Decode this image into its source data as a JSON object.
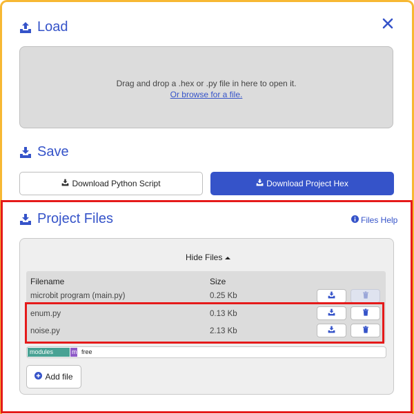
{
  "load": {
    "title": "Load",
    "drop_text": "Drag and drop a .hex or .py file in here to open it.",
    "browse_link": "Or browse for a file."
  },
  "save": {
    "title": "Save",
    "download_python_label": "Download Python Script",
    "download_hex_label": "Download Project Hex"
  },
  "project": {
    "title": "Project Files",
    "help_link": "Files Help",
    "hide_files_label": "Hide Files",
    "columns": {
      "filename": "Filename",
      "size": "Size"
    },
    "files": [
      {
        "name": "microbit program (main.py)",
        "size": "0.25 Kb",
        "deletable": false
      },
      {
        "name": "enum.py",
        "size": "0.13 Kb",
        "deletable": true
      },
      {
        "name": "noise.py",
        "size": "2.13 Kb",
        "deletable": true
      }
    ],
    "memory": {
      "modules_label": "modules",
      "main_label": "m",
      "free_label": "free",
      "modules_color": "#48a294",
      "main_color": "#8e5bc8"
    },
    "add_file_label": "Add file"
  },
  "colors": {
    "accent": "#3553c9",
    "frame_border": "#f7b833",
    "highlight": "#e51a1a"
  },
  "icons": {
    "load": "upload-icon",
    "save": "download-icon",
    "close": "close-icon",
    "help": "info-circle-icon",
    "caret": "caret-up-icon",
    "row_download": "download-icon",
    "row_delete": "trash-icon",
    "add": "plus-circle-icon"
  }
}
